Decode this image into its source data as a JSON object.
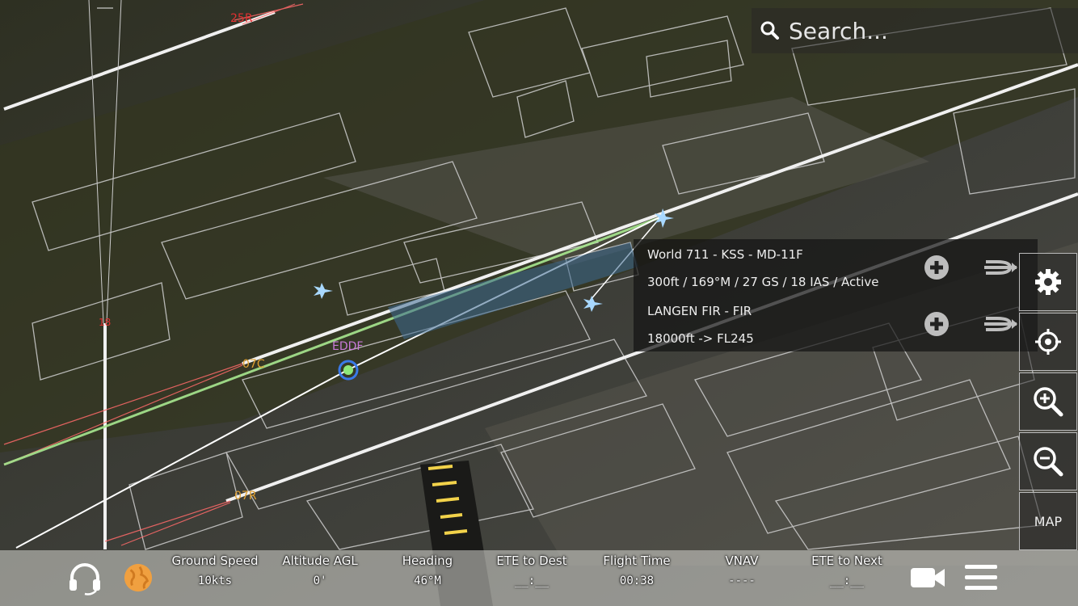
{
  "search": {
    "placeholder": "Search..."
  },
  "map": {
    "runway_labels": [
      "25R",
      "07C",
      "07R",
      "18"
    ],
    "airport_code": "EDDF",
    "colors": {
      "runway_label": "#e0a030",
      "runway_label_red": "#e03030",
      "airport": "#c87ad8",
      "approach_green": "#a8e890",
      "approach_red": "#ff6a6a"
    }
  },
  "info_panel": {
    "entries": [
      {
        "title": "World 711 - KSS - MD-11F",
        "detail": "300ft / 169°M / 27 GS / 18 IAS / Active"
      },
      {
        "title": "LANGEN FIR - FIR",
        "detail": "18000ft -> FL245"
      }
    ],
    "icons": [
      "plus-circle-icon",
      "route-icon"
    ]
  },
  "side_buttons": {
    "map_label": "MAP",
    "icons": [
      "gear-icon",
      "crosshair-icon",
      "zoom-in-icon",
      "zoom-out-icon"
    ]
  },
  "bottom_bar": {
    "stats": [
      {
        "label": "Ground Speed",
        "value": "10kts"
      },
      {
        "label": "Altitude AGL",
        "value": "0'"
      },
      {
        "label": "Heading",
        "value": "46°M"
      },
      {
        "label": "ETE to Dest",
        "value": "__:__"
      },
      {
        "label": "Flight Time",
        "value": "00:38"
      },
      {
        "label": "VNAV",
        "value": "----"
      },
      {
        "label": "ETE to Next",
        "value": "__:__"
      }
    ],
    "icons": [
      "headset-icon",
      "globe-icon",
      "camera-icon",
      "menu-icon"
    ]
  }
}
